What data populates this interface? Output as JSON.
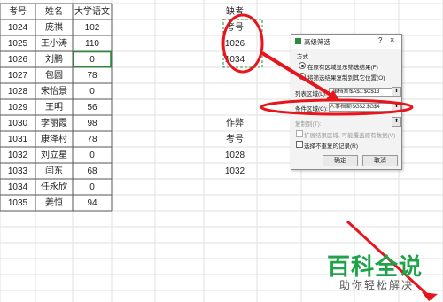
{
  "sheet": {
    "headers": [
      "考号",
      "姓名",
      "大学语文"
    ],
    "rows": [
      [
        "1024",
        "庞祺",
        "102"
      ],
      [
        "1025",
        "王小涛",
        "110"
      ],
      [
        "1026",
        "刘鹏",
        "0"
      ],
      [
        "1027",
        "包圆",
        "78"
      ],
      [
        "1028",
        "宋怡景",
        "0"
      ],
      [
        "1029",
        "王明",
        "56"
      ],
      [
        "1030",
        "李丽霞",
        "98"
      ],
      [
        "1031",
        "康泽村",
        "78"
      ],
      [
        "1032",
        "刘立星",
        "0"
      ],
      [
        "1033",
        "闫东",
        "68"
      ],
      [
        "1034",
        "任永欣",
        "0"
      ],
      [
        "1035",
        "姜恒",
        "94"
      ]
    ],
    "criteria_label": "缺考",
    "criteria": [
      "考号",
      "1026",
      "1034"
    ],
    "cheat_label": "作弊",
    "cheat": [
      "考号",
      "1028",
      "1032"
    ]
  },
  "dialog": {
    "title": "高级筛选",
    "help": "?",
    "close": "×",
    "mode_label": "方式",
    "option_inplace": "在原有区域显示筛选结果(F)",
    "option_copy": "将筛选结果复制到其它位置(O)",
    "list_range_label": "列表区域(L):",
    "list_range_value": "_事档案!$A$1:$C$13",
    "criteria_range_label": "条件区域(C):",
    "criteria_range_value": "人事档案!$G$2:$G$4",
    "copy_to_label": "复制到(T):",
    "expand_label": "扩展结果区域, 可能覆盖原有数据(V)",
    "unique_label": "选择不重复的记录(R)",
    "ok": "确定",
    "cancel": "取消"
  },
  "watermark": {
    "logo": "百科全说",
    "tagline": "助你轻松解决"
  },
  "colors": {
    "annotation": "#e8141c",
    "selection": "#2e8b3d",
    "watermark": "#1ea34a"
  }
}
